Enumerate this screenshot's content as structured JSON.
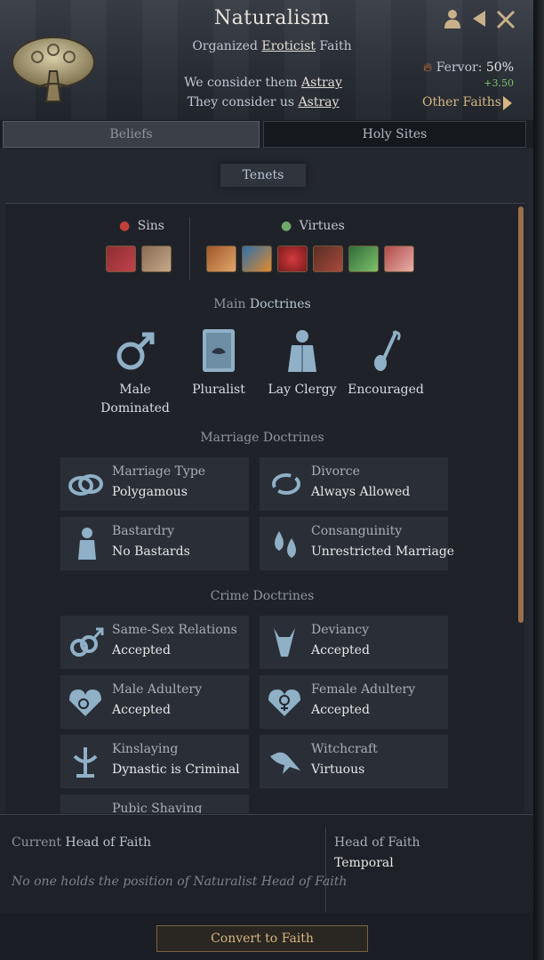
{
  "header": {
    "title": "Naturalism",
    "subtitle_prefix": "Organized",
    "subtitle_religion": "Eroticist",
    "subtitle_suffix": "Faith",
    "we_consider_prefix": "We consider them",
    "we_consider_value": "Astray",
    "they_consider_prefix": "They consider us",
    "they_consider_value": "Astray",
    "fervor_label": "Fervor:",
    "fervor_value": "50%",
    "fervor_delta": "+3.50",
    "other_faiths": "Other Faiths",
    "icons": [
      "person-icon",
      "back-arrow-icon",
      "close-icon"
    ]
  },
  "tabs": [
    {
      "label": "Beliefs",
      "active": true
    },
    {
      "label": "Holy Sites",
      "active": false
    }
  ],
  "tenets_button": "Tenets",
  "sins_label": "Sins",
  "virtues_label": "Virtues",
  "sins": [
    "lustful-trait-icon",
    "greedy-trait-icon"
  ],
  "virtues": [
    "gluttonous-trait-icon",
    "fickle-trait-icon",
    "heart-trait-icon",
    "wrathful-trait-icon",
    "arbitrary-trait-icon",
    "compassionate-trait-icon"
  ],
  "main_doctrines": {
    "label_a": "Main",
    "label_b": "Doctrines",
    "items": [
      {
        "icon": "male-symbol-icon",
        "line1": "Male",
        "line2": "Dominated"
      },
      {
        "icon": "scripture-book-icon",
        "line1": "Pluralist",
        "line2": ""
      },
      {
        "icon": "cleric-icon",
        "line1": "Lay Clergy",
        "line2": ""
      },
      {
        "icon": "pilgrim-staff-icon",
        "line1": "Encouraged",
        "line2": ""
      }
    ]
  },
  "marriage_doctrines": {
    "label": "Marriage Doctrines",
    "items": [
      {
        "icon": "rings-icon",
        "title": "Marriage Type",
        "value": "Polygamous"
      },
      {
        "icon": "broken-ring-icon",
        "title": "Divorce",
        "value": "Always Allowed"
      },
      {
        "icon": "baby-icon",
        "title": "Bastardry",
        "value": "No Bastards"
      },
      {
        "icon": "blood-drops-icon",
        "title": "Consanguinity",
        "value": "Unrestricted Marriage"
      }
    ]
  },
  "crime_doctrines": {
    "label": "Crime Doctrines",
    "items": [
      {
        "icon": "double-male-icon",
        "title": "Same-Sex Relations",
        "value": "Accepted"
      },
      {
        "icon": "goat-head-icon",
        "title": "Deviancy",
        "value": "Accepted"
      },
      {
        "icon": "male-heart-icon",
        "title": "Male Adultery",
        "value": "Accepted"
      },
      {
        "icon": "female-heart-icon",
        "title": "Female Adultery",
        "value": "Accepted"
      },
      {
        "icon": "kinslaying-icon",
        "title": "Kinslaying",
        "value": "Dynastic is Criminal"
      },
      {
        "icon": "raven-icon",
        "title": "Witchcraft",
        "value": "Virtuous"
      },
      {
        "icon": "shaving-icon",
        "title": "Pubic Shaving",
        "value": ""
      }
    ]
  },
  "footer": {
    "head_label_a": "Current",
    "head_label_b": "Head of Faith",
    "head_empty": "No one holds the position of Naturalist Head of Faith",
    "hof_type_label": "Head of Faith",
    "hof_type_value": "Temporal",
    "convert_button": "Convert to Faith"
  },
  "colors": {
    "gold": "#d7b783",
    "accent_blue": "#b8c4d2",
    "fervor_green": "#7fc46a"
  }
}
